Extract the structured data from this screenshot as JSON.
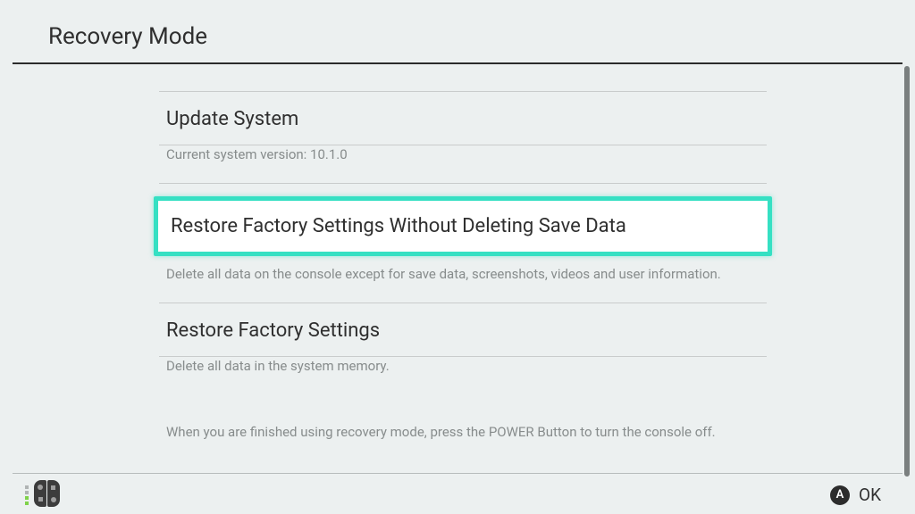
{
  "header": {
    "title": "Recovery Mode"
  },
  "options": {
    "update": {
      "title": "Update System",
      "desc": "Current system version: 10.1.0"
    },
    "restore_keep": {
      "title": "Restore Factory Settings Without Deleting Save Data",
      "desc": "Delete all data on the console except for save data, screenshots, videos and user information."
    },
    "restore_full": {
      "title": "Restore Factory Settings",
      "desc": "Delete all data in the system memory."
    }
  },
  "finish_note": "When you are finished using recovery mode, press the POWER Button to turn the console off.",
  "footer": {
    "a_glyph": "A",
    "ok_label": "OK"
  }
}
